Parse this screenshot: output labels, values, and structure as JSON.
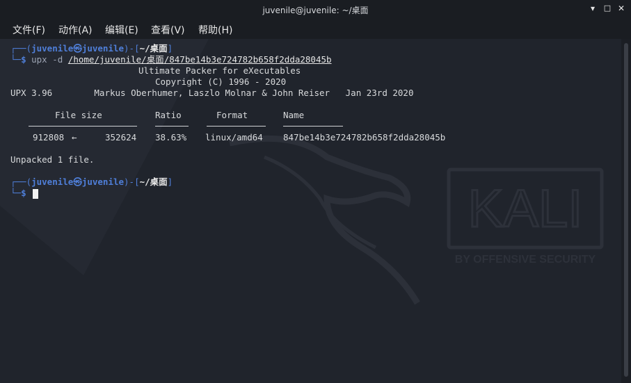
{
  "window": {
    "title": "juvenile@juvenile: ~/桌面",
    "minimize": "▾",
    "maximize": "□",
    "close": "✕"
  },
  "menu": [
    "文件(F)",
    "动作(A)",
    "编辑(E)",
    "查看(V)",
    "帮助(H)"
  ],
  "prompt": {
    "frame_top": "┌──(",
    "user_host": "juvenile㉿juvenile",
    "sep": ")-[",
    "dir": "~/桌面",
    "close": "]",
    "frame_bottom": "└─",
    "dollar": "$"
  },
  "command": {
    "program": "upx",
    "flag": "-d",
    "dir_arg": "/home/juvenile/桌面",
    "file_arg": "/847be14b3e724782b658f2dda28045b"
  },
  "output": {
    "banner1": "Ultimate Packer for eXecutables",
    "banner2": "Copyright (C) 1996 - 2020",
    "version_line": "UPX 3.96        Markus Oberhumer, Laszlo Molnar & John Reiser   Jan 23rd 2020",
    "headers": {
      "file_size": "File size",
      "ratio": "Ratio",
      "format": "Format",
      "name": "Name"
    },
    "row": {
      "size_before": "912808",
      "arrow": "←",
      "size_after": "352624",
      "ratio": "38.63%",
      "format": "linux/amd64",
      "name": "847be14b3e724782b658f2dda28045b"
    },
    "summary": "Unpacked 1 file."
  },
  "watermark": {
    "logo": "KALI",
    "tagline": "BY OFFENSIVE SECURITY"
  },
  "colors": {
    "background": "#20242c",
    "prompt_accent": "#4f7fd9",
    "text": "#d8dadc"
  }
}
